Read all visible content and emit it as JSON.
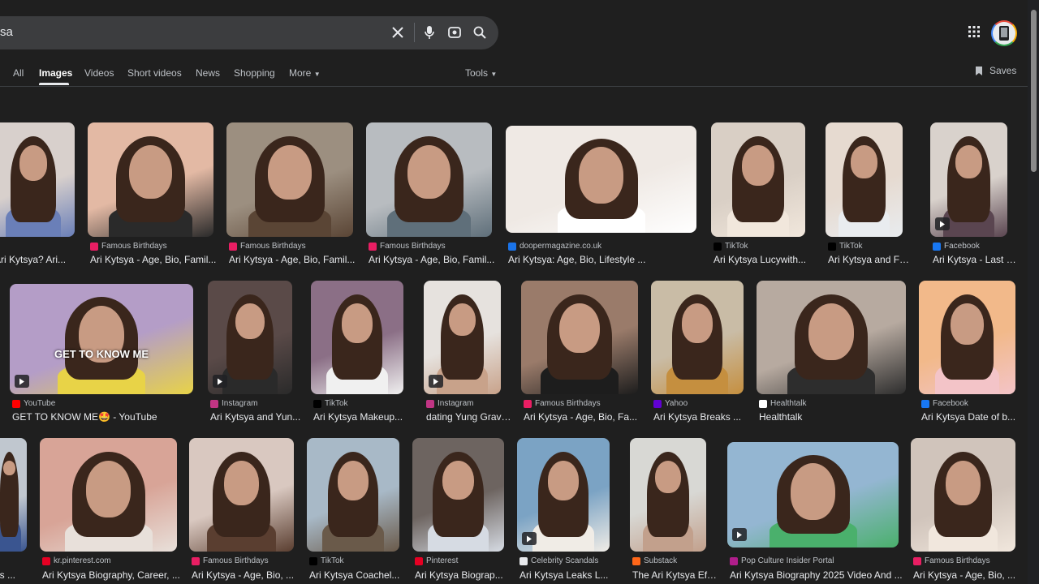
{
  "search": {
    "query": "sa"
  },
  "tabs": [
    {
      "label": "All",
      "active": false
    },
    {
      "label": "Images",
      "active": true
    },
    {
      "label": "Videos",
      "active": false
    },
    {
      "label": "Short videos",
      "active": false
    },
    {
      "label": "News",
      "active": false
    },
    {
      "label": "Shopping",
      "active": false
    },
    {
      "label": "More",
      "active": false
    },
    {
      "label": "Tools",
      "active": false
    }
  ],
  "saves_label": "Saves",
  "colors": {
    "background": "#1f1f1f",
    "search_bg": "#3c3d3f",
    "text": "#e8eaed",
    "muted": "#bdc1c6"
  },
  "results": [
    {
      "source": "",
      "title": "Ari Kytsya? Ari...",
      "favicon": "",
      "video": false,
      "overlay": ""
    },
    {
      "source": "Famous Birthdays",
      "title": "Ari Kytsya - Age, Bio, Famil...",
      "favicon": "famous-birthdays-icon",
      "video": false,
      "overlay": ""
    },
    {
      "source": "Famous Birthdays",
      "title": "Ari Kytsya - Age, Bio, Famil...",
      "favicon": "famous-birthdays-icon",
      "video": false,
      "overlay": ""
    },
    {
      "source": "Famous Birthdays",
      "title": "Ari Kytsya - Age, Bio, Famil...",
      "favicon": "famous-birthdays-icon",
      "video": false,
      "overlay": ""
    },
    {
      "source": "doopermagazine.co.uk",
      "title": "Ari Kytsya: Age, Bio, Lifestyle ...",
      "favicon": "dooper-icon",
      "video": false,
      "overlay": ""
    },
    {
      "source": "TikTok",
      "title": "Ari Kytsya Lucywith...",
      "favicon": "tiktok-icon",
      "video": false,
      "overlay": ""
    },
    {
      "source": "TikTok",
      "title": "Ari Kytsya and Fay...",
      "favicon": "tiktok-icon",
      "video": false,
      "overlay": ""
    },
    {
      "source": "Facebook",
      "title": "Ari Kytsya - Last ti...",
      "favicon": "facebook-icon",
      "video": true,
      "overlay": ""
    },
    {
      "source": "YouTube",
      "title": "GET TO KNOW ME🤩 - YouTube",
      "favicon": "youtube-icon",
      "video": true,
      "overlay": "GET TO KNOW ME"
    },
    {
      "source": "Instagram",
      "title": "Ari Kytsya and Yun...",
      "favicon": "instagram-icon",
      "video": true,
      "overlay": ""
    },
    {
      "source": "TikTok",
      "title": "Ari Kytsya Makeup...",
      "favicon": "tiktok-icon",
      "video": false,
      "overlay": ""
    },
    {
      "source": "Instagram",
      "title": "dating Yung Gravy ...",
      "favicon": "instagram-icon",
      "video": true,
      "overlay": ""
    },
    {
      "source": "Famous Birthdays",
      "title": "Ari Kytsya - Age, Bio, Fa...",
      "favicon": "famous-birthdays-icon",
      "video": false,
      "overlay": ""
    },
    {
      "source": "Yahoo",
      "title": "Ari Kytsya Breaks ...",
      "favicon": "yahoo-icon",
      "video": false,
      "overlay": ""
    },
    {
      "source": "Healthtalk",
      "title": "Healthtalk",
      "favicon": "healthtalk-icon",
      "video": false,
      "overlay": ""
    },
    {
      "source": "Facebook",
      "title": "Ari Kytsya Date of b...",
      "favicon": "facebook-icon",
      "video": false,
      "overlay": ""
    },
    {
      "source": "",
      "title": "ds ...",
      "favicon": "",
      "video": false,
      "overlay": ""
    },
    {
      "source": "kr.pinterest.com",
      "title": "Ari Kytsya Biography, Career, ...",
      "favicon": "pinterest-icon",
      "video": false,
      "overlay": ""
    },
    {
      "source": "Famous Birthdays",
      "title": "Ari Kytsya - Age, Bio, ...",
      "favicon": "famous-birthdays-icon",
      "video": false,
      "overlay": ""
    },
    {
      "source": "TikTok",
      "title": "Ari Kytsya Coachel...",
      "favicon": "tiktok-icon",
      "video": false,
      "overlay": ""
    },
    {
      "source": "Pinterest",
      "title": "Ari Kytsya Biograp...",
      "favicon": "pinterest-icon",
      "video": false,
      "overlay": ""
    },
    {
      "source": "Celebrity Scandals",
      "title": "Ari Kytsya Leaks L...",
      "favicon": "celebrity-scandals-icon",
      "video": true,
      "overlay": ""
    },
    {
      "source": "Substack",
      "title": "The Ari Kytsya Effe...",
      "favicon": "substack-icon",
      "video": false,
      "overlay": ""
    },
    {
      "source": "Pop Culture Insider Portal",
      "title": "Ari Kytsya Biography 2025 Video And ...",
      "favicon": "pop-culture-icon",
      "video": true,
      "overlay": ""
    },
    {
      "source": "Famous Birthdays",
      "title": "Ari Kytsya - Age, Bio, ...",
      "favicon": "famous-birthdays-icon",
      "video": false,
      "overlay": ""
    }
  ]
}
